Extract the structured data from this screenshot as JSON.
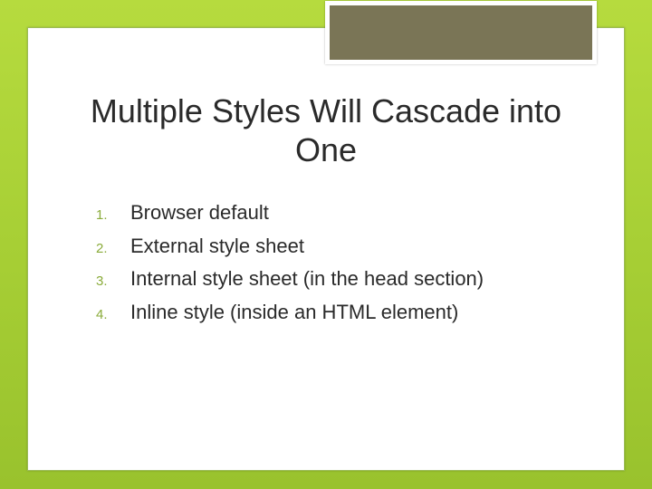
{
  "title": "Multiple Styles Will Cascade into One",
  "items": [
    {
      "num": "1.",
      "text": "Browser default"
    },
    {
      "num": "2.",
      "text": "External style sheet"
    },
    {
      "num": "3.",
      "text": "Internal style sheet (in the head section)"
    },
    {
      "num": "4.",
      "text": "Inline style (inside an HTML element)"
    }
  ]
}
